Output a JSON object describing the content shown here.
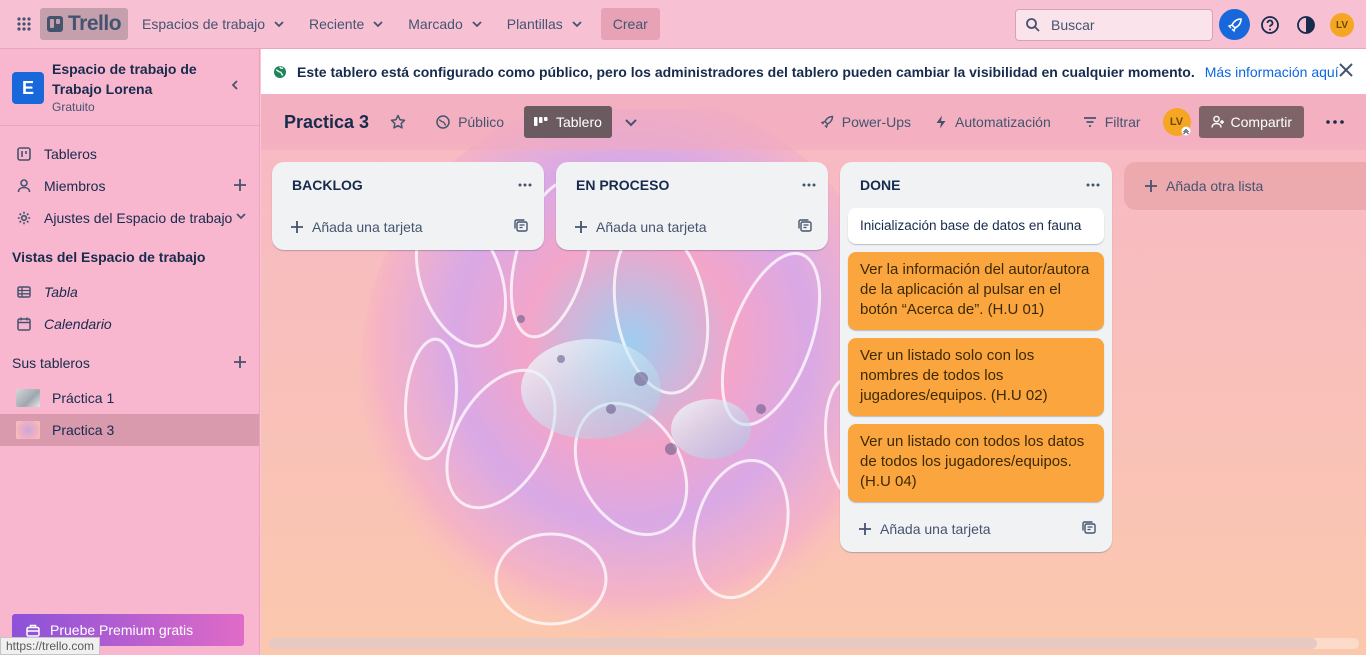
{
  "topbar": {
    "logo": "Trello",
    "nav": [
      "Espacios de trabajo",
      "Reciente",
      "Marcado",
      "Plantillas"
    ],
    "create_label": "Crear",
    "search_placeholder": "Buscar",
    "avatar_initials": "LV"
  },
  "sidebar": {
    "workspace_initial": "E",
    "workspace_name": "Espacio de trabajo de Trabajo Lorena",
    "workspace_plan": "Gratuito",
    "items": [
      {
        "label": "Tableros",
        "icon": "board-icon"
      },
      {
        "label": "Miembros",
        "icon": "person-icon"
      },
      {
        "label": "Ajustes del Espacio de trabajo",
        "icon": "gear-icon"
      }
    ],
    "views_heading": "Vistas del Espacio de trabajo",
    "views": [
      {
        "label": "Tabla",
        "icon": "table-icon"
      },
      {
        "label": "Calendario",
        "icon": "calendar-icon"
      }
    ],
    "boards_heading": "Sus tableros",
    "boards": [
      {
        "label": "Práctica 1"
      },
      {
        "label": "Practica 3"
      }
    ],
    "premium_label": "Pruebe Premium gratis"
  },
  "statusbar": {
    "url": "https://trello.com"
  },
  "notice": {
    "message": "Este tablero está configurado como público, pero los administradores del tablero pueden cambiar la visibilidad en cualquier momento.",
    "link": "Más información aquí"
  },
  "board": {
    "title": "Practica 3",
    "visibility": "Público",
    "view": "Tablero",
    "powerups": "Power-Ups",
    "automation": "Automatización",
    "filter": "Filtrar",
    "share": "Compartir",
    "member_initials": "LV"
  },
  "lists": [
    {
      "title": "BACKLOG",
      "add_label": "Añada una tarjeta",
      "cards": []
    },
    {
      "title": "EN PROCESO",
      "add_label": "Añada una tarjeta",
      "cards": []
    },
    {
      "title": "DONE",
      "add_label": "Añada una tarjeta",
      "cards": [
        "Inicialización base de datos en fauna",
        "Ver la información del autor/autora de la aplicación al pulsar en el botón “Acerca de”. (H.U 01)",
        "Ver un listado solo con los nombres de todos los jugadores/equipos. (H.U 02)",
        "Ver un listado con todos los datos de todos los jugadores/equipos. (H.U 04)"
      ]
    }
  ],
  "add_list_label": "Añada otra lista",
  "colors": {
    "accent": "#1868db",
    "card_orange": "#faa53d",
    "avatar": "#f5a623"
  }
}
